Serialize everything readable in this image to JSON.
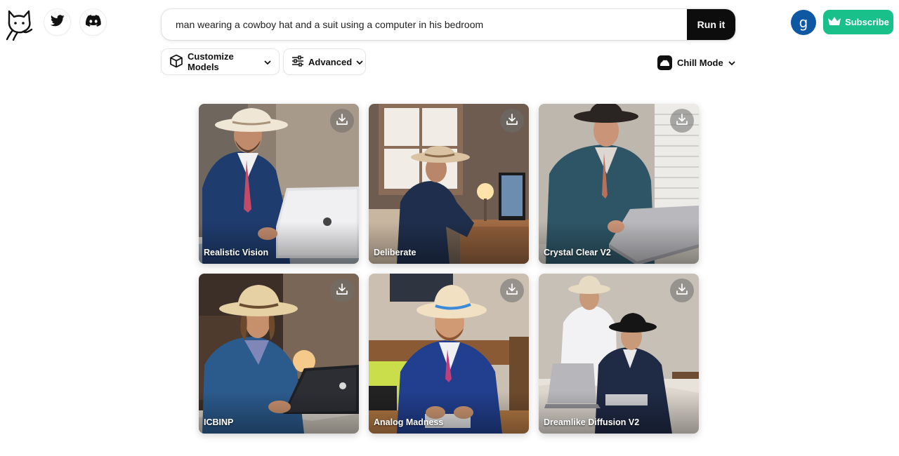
{
  "header": {
    "logo_icon": "cat-logo-icon",
    "social": [
      {
        "name": "twitter",
        "icon": "twitter-icon"
      },
      {
        "name": "discord",
        "icon": "discord-icon"
      }
    ]
  },
  "search": {
    "value": "man wearing a cowboy hat and a suit using a computer in his bedroom",
    "run_label": "Run it"
  },
  "user": {
    "avatar_letter": "g",
    "avatar_color": "#0e57a3",
    "subscribe_label": "Subscribe",
    "subscribe_color": "#19c08a"
  },
  "toolbar": {
    "customize_models_label": "Customize Models",
    "advanced_label": "Advanced",
    "chill_mode_label": "Chill Mode"
  },
  "results": [
    {
      "model": "Realistic Vision"
    },
    {
      "model": "Deliberate"
    },
    {
      "model": "Crystal Clear V2"
    },
    {
      "model": "ICBINP"
    },
    {
      "model": "Analog Madness"
    },
    {
      "model": "Dreamlike Diffusion V2"
    }
  ]
}
